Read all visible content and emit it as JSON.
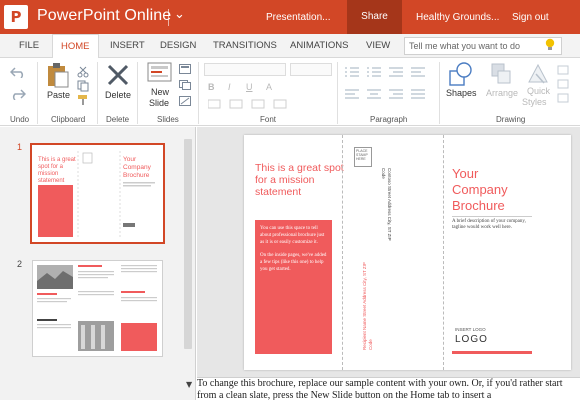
{
  "titlebar": {
    "app_logo_letter": "P",
    "app_name": "PowerPoint Online",
    "document_name": "Presentation...",
    "share_label": "Share",
    "workspace_name": "Healthy Grounds...",
    "signout_label": "Sign out",
    "color": "#d24726"
  },
  "tabs": [
    {
      "label": "FILE"
    },
    {
      "label": "HOME",
      "active": true
    },
    {
      "label": "INSERT"
    },
    {
      "label": "DESIGN"
    },
    {
      "label": "TRANSITIONS"
    },
    {
      "label": "ANIMATIONS"
    },
    {
      "label": "VIEW"
    }
  ],
  "tell_me_placeholder": "Tell me what you want to do",
  "ribbon": {
    "groups": [
      "Undo",
      "Clipboard",
      "Delete",
      "Slides",
      "Font",
      "Paragraph",
      "Drawing"
    ],
    "paste_label": "Paste",
    "delete_label": "Delete",
    "new_slide_label_1": "New",
    "new_slide_label_2": "Slide",
    "shapes_label": "Shapes",
    "arrange_label": "Arrange",
    "quick_styles_label_1": "Quick",
    "quick_styles_label_2": "Styles",
    "font_bold": "B",
    "font_italic": "I",
    "font_underline": "U",
    "font_color_letter": "A"
  },
  "thumbnails": [
    {
      "number": "1",
      "selected": true
    },
    {
      "number": "2",
      "selected": false
    }
  ],
  "slide": {
    "mission_heading": "This is a great spot for a mission statement",
    "mission_body": "You can use this space to tell about professional brochure just as it is or easily customize it.",
    "mission_body_2": "On the inside pages, we've added a few tips (like this one) to help you get started.",
    "postage": "PLACE STAMP HERE",
    "return_address": "Contoso Street Address City, ST ZIP Code",
    "mailing_address": "Recipient Name Street Address City, ST ZIP Code",
    "company_title": "Your Company Brochure",
    "company_subtitle": "A brief description of your company, tagline would work well here.",
    "logo_caption": "INSERT LOGO",
    "logo": "LOGO",
    "accent": "#f05b5c"
  },
  "notes": "To change this brochure, replace our sample content with your own. Or, if you'd rather start from a clean slate, press the New Slide button on the Home tab to insert a"
}
